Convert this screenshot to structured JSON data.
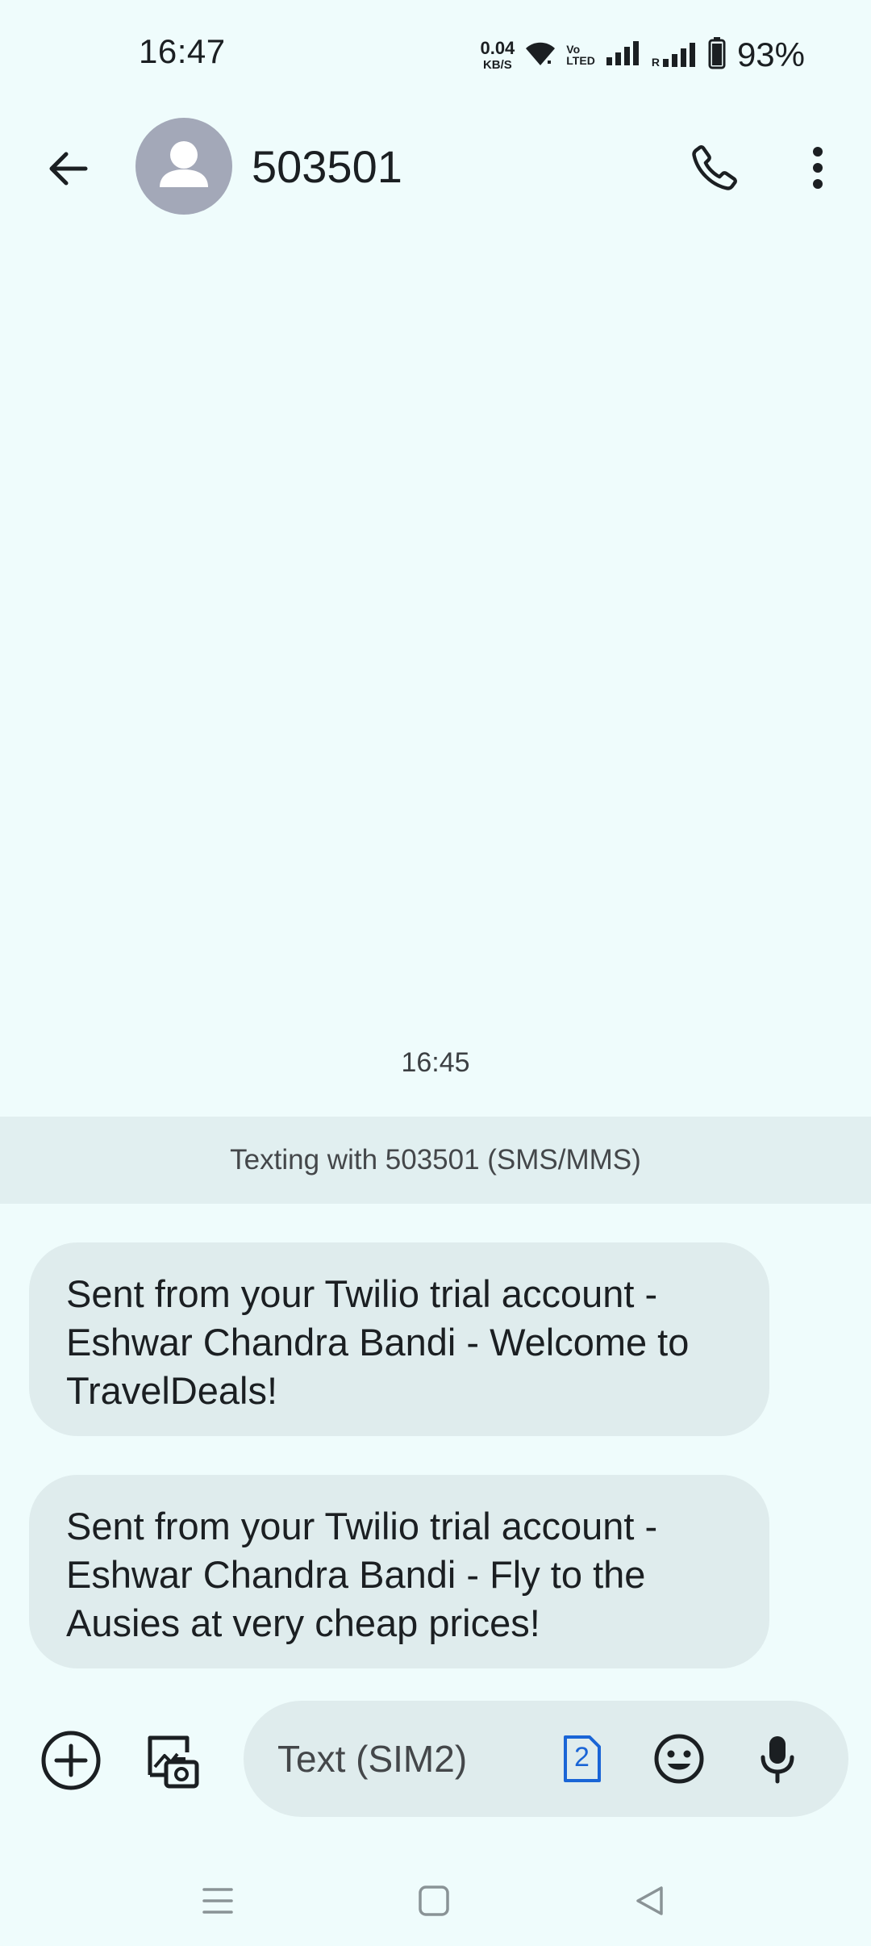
{
  "status_bar": {
    "time": "16:47",
    "net_speed_value": "0.04",
    "net_speed_unit": "KB/S",
    "volte_top": "Vo",
    "volte_bottom": "LTED",
    "roaming_indicator": "R",
    "battery_percent": "93%",
    "icons": [
      "wifi-icon",
      "volte-icon",
      "signal-icon",
      "roaming-signal-icon",
      "battery-icon"
    ]
  },
  "header": {
    "contact_name": "503501",
    "icons": [
      "back-arrow-icon",
      "avatar-person-icon",
      "phone-icon",
      "more-vert-icon"
    ]
  },
  "conversation": {
    "timestamp": "16:45",
    "banner": "Texting with 503501 (SMS/MMS)",
    "messages": [
      {
        "text": "Sent from your Twilio trial account - Eshwar Chandra Bandi - Welcome to TravelDeals!"
      },
      {
        "text": "Sent from your Twilio trial account - Eshwar Chandra Bandi - Fly to the Ausies at very cheap prices!"
      }
    ]
  },
  "compose": {
    "placeholder": "Text (SIM2)",
    "sim_number": "2",
    "sim_color": "#1a65d6",
    "icons": [
      "add-circle-icon",
      "gallery-camera-icon",
      "sim-card-icon",
      "emoji-icon",
      "mic-icon"
    ]
  },
  "nav_bar": {
    "icons": [
      "menu-lines-icon",
      "home-square-icon",
      "back-triangle-icon"
    ]
  }
}
